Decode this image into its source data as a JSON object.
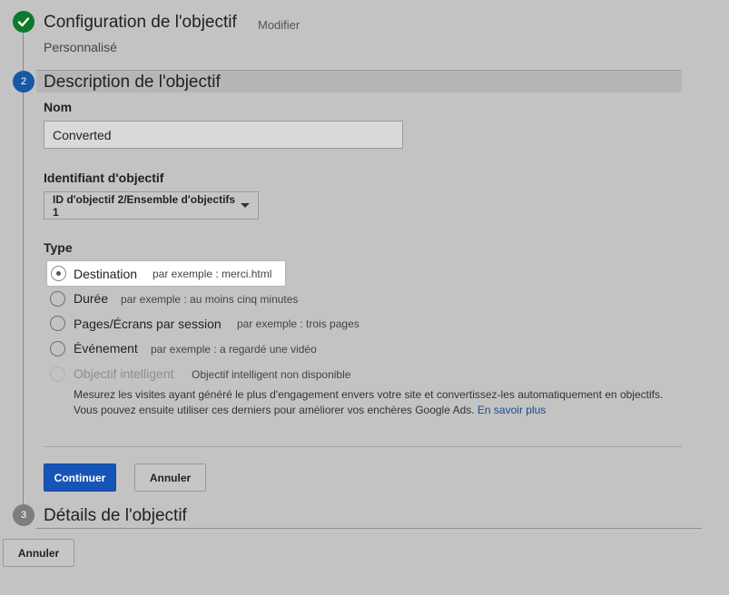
{
  "step1": {
    "title": "Configuration de l'objectif",
    "edit_label": "Modifier",
    "summary": "Personnalisé"
  },
  "step2": {
    "number": "2",
    "title": "Description de l'objectif",
    "name_label": "Nom",
    "name_value": "Converted",
    "goal_id_label": "Identifiant d'objectif",
    "goal_id_value": "ID d'objectif 2/Ensemble d'objectifs 1",
    "type_label": "Type",
    "types": [
      {
        "label": "Destination",
        "example": "par exemple : merci.html",
        "checked": true
      },
      {
        "label": "Durée",
        "example": "par exemple : au moins cinq minutes"
      },
      {
        "label": "Pages/Écrans par session",
        "example": "par exemple : trois pages"
      },
      {
        "label": "Événement",
        "example": "par exemple : a regardé une vidéo"
      },
      {
        "label": "Objectif intelligent",
        "example": "Objectif intelligent non disponible",
        "disabled": true
      }
    ],
    "smart_desc_line1": "Mesurez les visites ayant généré le plus d'engagement envers votre site et convertissez-les automatiquement en objectifs.",
    "smart_desc_line2": "Vous pouvez ensuite utiliser ces derniers pour améliorer vos enchères Google Ads.",
    "learn_more": "En savoir plus",
    "continue_label": "Continuer",
    "cancel_label": "Annuler"
  },
  "step3": {
    "number": "3",
    "title": "Détails de l'objectif"
  },
  "footer": {
    "cancel_label": "Annuler"
  },
  "colors": {
    "primary_button": "#1754b8",
    "step_done": "#0c7a2c",
    "step_active": "#1658a3"
  }
}
